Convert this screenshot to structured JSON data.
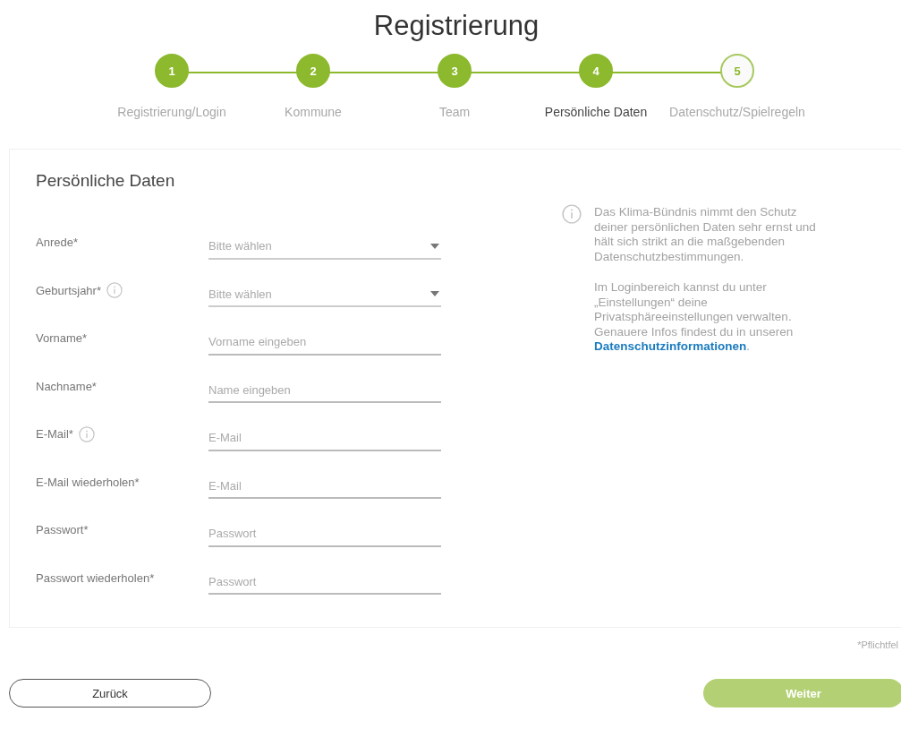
{
  "title": "Registrierung",
  "steps": [
    {
      "number": "1",
      "label": "Registrierung/Login",
      "done": true,
      "selected": false
    },
    {
      "number": "2",
      "label": "Kommune",
      "done": true,
      "selected": false
    },
    {
      "number": "3",
      "label": "Team",
      "done": true,
      "selected": false
    },
    {
      "number": "4",
      "label": "Persönliche Daten",
      "done": true,
      "selected": true
    },
    {
      "number": "5",
      "label": "Datenschutz/Spielregeln",
      "done": false,
      "selected": false
    }
  ],
  "form": {
    "heading": "Persönliche Daten",
    "fields": [
      {
        "kind": "select",
        "label": "Anrede*",
        "placeholder": "Bitte wählen",
        "info": false
      },
      {
        "kind": "select",
        "label": "Geburtsjahr*",
        "placeholder": "Bitte wählen",
        "info": true
      },
      {
        "kind": "input",
        "label": "Vorname*",
        "placeholder": "Vorname eingeben",
        "info": false
      },
      {
        "kind": "input",
        "label": "Nachname*",
        "placeholder": "Name eingeben",
        "info": false
      },
      {
        "kind": "input",
        "label": "E-Mail*",
        "placeholder": "E-Mail",
        "info": true
      },
      {
        "kind": "input",
        "label": "E-Mail wiederholen*",
        "placeholder": "E-Mail",
        "info": false
      },
      {
        "kind": "input",
        "label": "Passwort*",
        "placeholder": "Passwort",
        "info": false
      },
      {
        "kind": "input",
        "label": "Passwort wiederholen*",
        "placeholder": "Passwort",
        "info": false
      }
    ],
    "notice": {
      "paragraph_1": "Das Klima-Bündnis nimmt den Schutz deiner persönlichen Daten sehr ernst und hält sich strikt an die maßgebenden Datenschutzbestimmungen.",
      "paragraph_2": "Im Loginbereich kannst du unter „Einstellungen“ deine Privatsphäreeinstellungen verwalten. Genauere Infos findest du in unseren",
      "link": "Datenschutzinformationen",
      "link_suffix": "."
    }
  },
  "required_note": "*Pflichtfel",
  "buttons": [
    {
      "kind": "secondary",
      "label": "Zurück",
      "disabled": false
    },
    {
      "kind": "primary",
      "label": "Weiter",
      "disabled": true
    }
  ]
}
